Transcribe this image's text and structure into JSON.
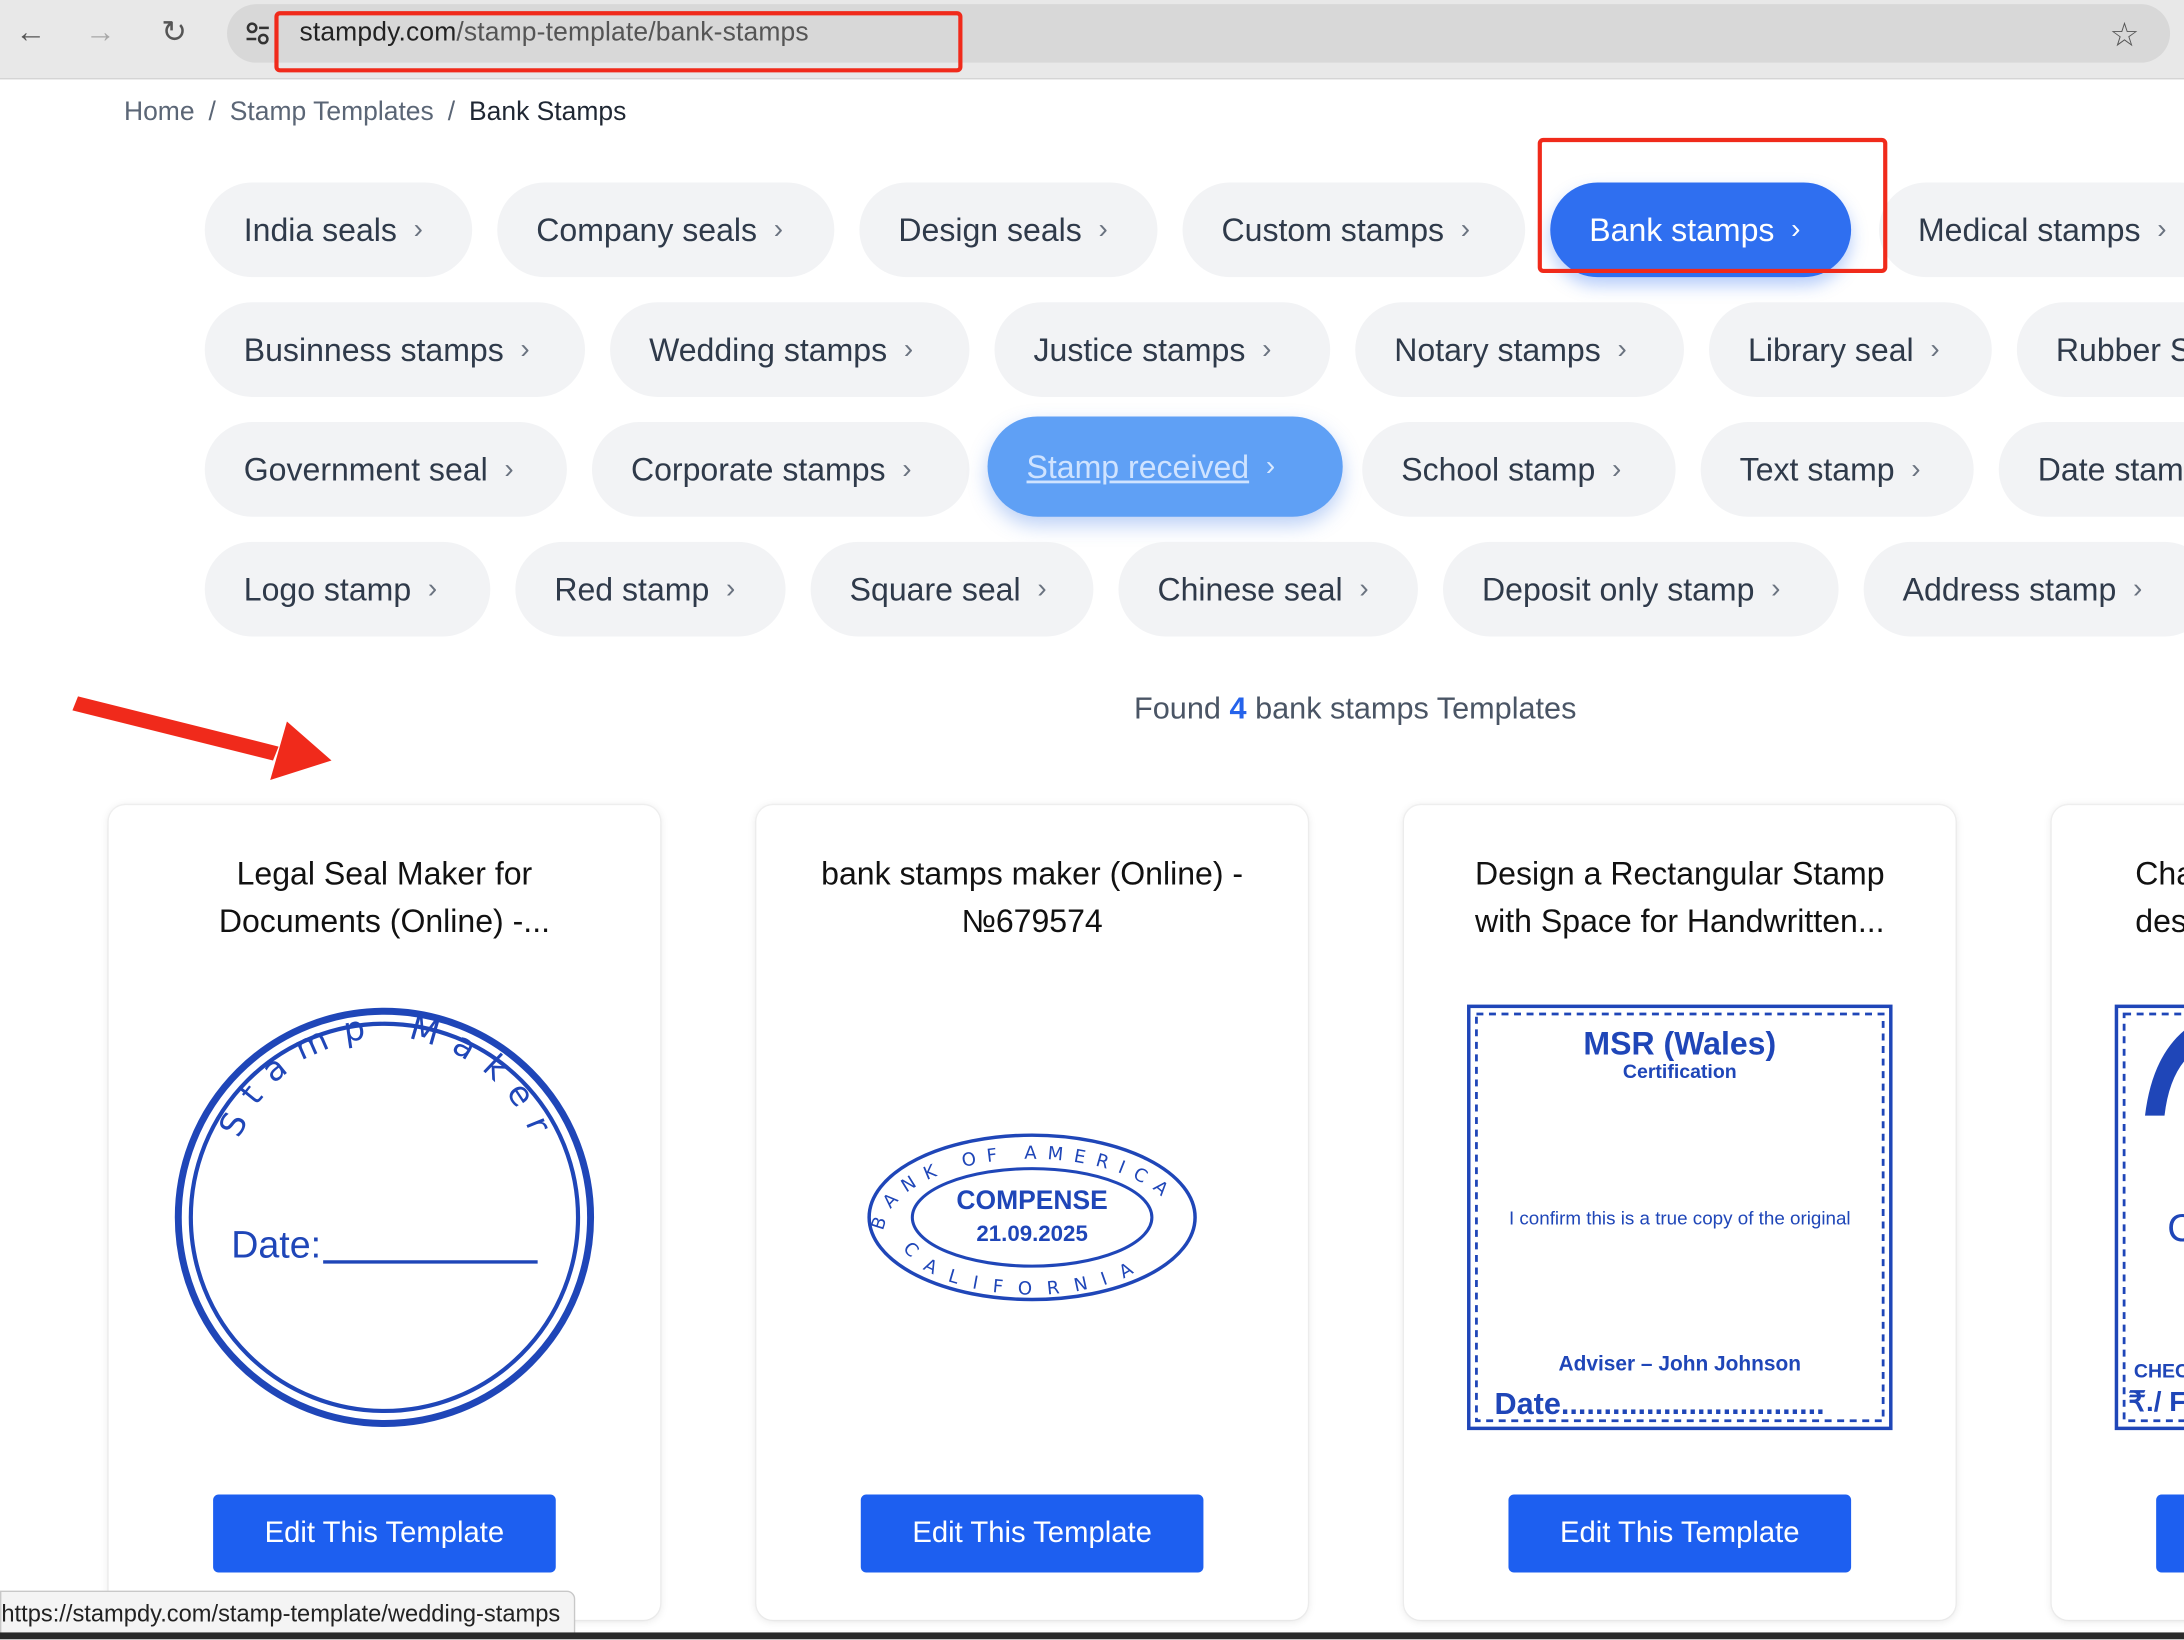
{
  "browser": {
    "url_host": "stampdy.com",
    "url_path": "/stamp-template/bank-stamps"
  },
  "breadcrumb": {
    "items": [
      "Home",
      "Stamp Templates",
      "Bank Stamps"
    ],
    "separator": "/"
  },
  "categories": [
    "India seals",
    "Company seals",
    "Design seals",
    "Custom stamps",
    "Bank stamps",
    "Medical stamps",
    "Businness stamps",
    "Wedding stamps",
    "Justice stamps",
    "Notary stamps",
    "Library seal",
    "Rubber S",
    "Government seal",
    "Corporate stamps",
    "Stamp received",
    "School stamp",
    "Text stamp",
    "Date stam",
    "Logo stamp",
    "Red stamp",
    "Square seal",
    "Chinese seal",
    "Deposit only stamp",
    "Address stamp"
  ],
  "active_category": "Bank stamps",
  "hovered_category": "Stamp received",
  "found": {
    "prefix": "Found",
    "count": "4",
    "suffix": "bank stamps Templates"
  },
  "cards": [
    {
      "title_line1": "Legal Seal Maker for",
      "title_line2": "Documents (Online) -...",
      "button": "Edit This Template",
      "stamp": {
        "arc_text": "Stamp Maker",
        "date_label": "Date:"
      }
    },
    {
      "title_line1": "bank stamps maker (Online) -",
      "title_line2": "№679574",
      "button": "Edit This Template",
      "stamp": {
        "top_arc": "BANK OF AMERICA",
        "bottom_arc": "CALIFORNIA",
        "main": "COMPENSE",
        "date": "21.09.2025"
      }
    },
    {
      "title_line1": "Design a Rectangular Stamp",
      "title_line2": "with Space for Handwritten...",
      "button": "Edit This Template",
      "stamp": {
        "heading": "MSR (Wales)",
        "subheading": "Certification",
        "body": "I confirm this is a true copy of the original",
        "signer": "Adviser – John Johnson",
        "date": "Date..............................."
      }
    },
    {
      "title_line1": "Cha",
      "title_line2": "des",
      "button": "",
      "stamp": {
        "letter": "C",
        "line1": "CHEC",
        "line2": "₹./ F"
      }
    }
  ],
  "status_url": "https://stampdy.com/stamp-template/wedding-stamps",
  "colors": {
    "primary": "#1d5ff0",
    "stamp_blue": "#1f46b8",
    "annotation": "#f02a1b"
  }
}
